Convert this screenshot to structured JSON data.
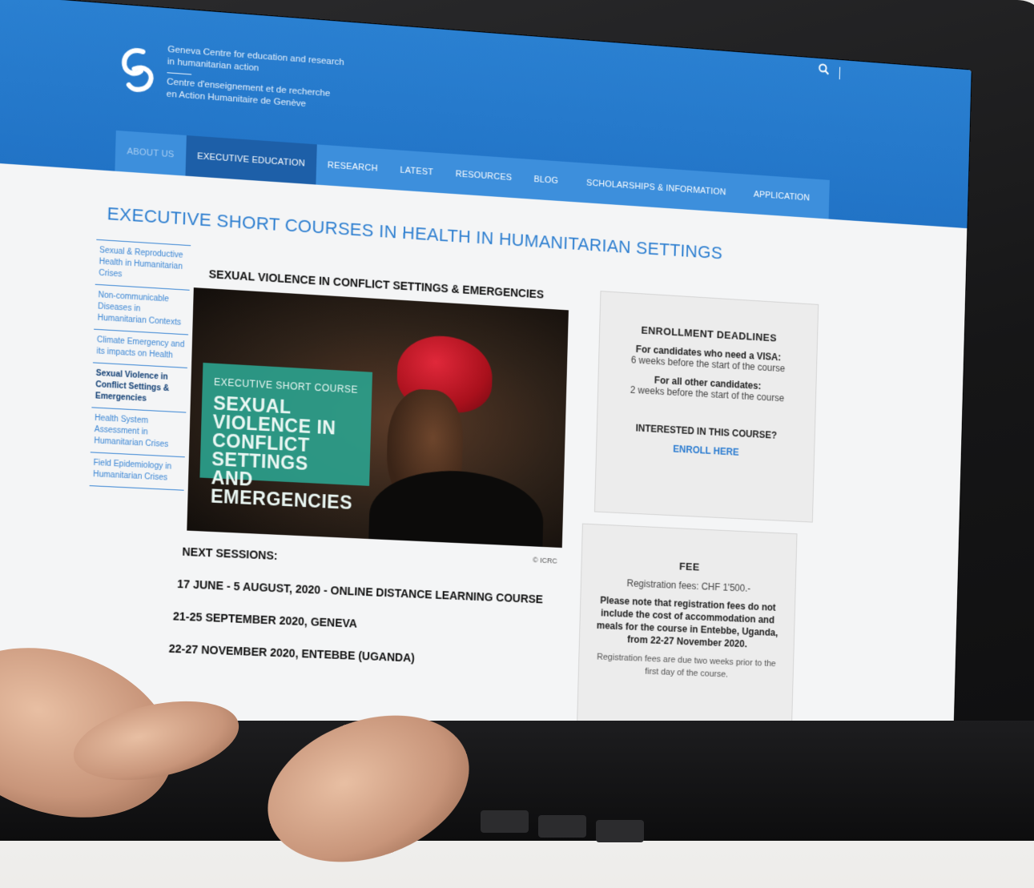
{
  "header": {
    "org_name_en_1": "Geneva Centre for education and research",
    "org_name_en_2": "in humanitarian action",
    "org_name_fr_1": "Centre d'enseignement et de recherche",
    "org_name_fr_2": "en Action Humanitaire de Genève",
    "search_icon": "search-icon"
  },
  "nav": {
    "items": [
      {
        "label": "ABOUT US"
      },
      {
        "label": "EXECUTIVE EDUCATION"
      },
      {
        "label": "RESEARCH"
      },
      {
        "label": "LATEST"
      },
      {
        "label": "RESOURCES"
      },
      {
        "label": "BLOG"
      },
      {
        "label": "SCHOLARSHIPS & INFORMATION"
      },
      {
        "label": "APPLICATION"
      }
    ]
  },
  "page": {
    "title": "EXECUTIVE SHORT COURSES IN HEALTH IN HUMANITARIAN SETTINGS",
    "course_heading": "SEXUAL VIOLENCE IN CONFLICT SETTINGS & EMERGENCIES"
  },
  "sidebar": {
    "items": [
      {
        "label": "Sexual & Reproductive Health in Humanitarian Crises"
      },
      {
        "label": "Non-communicable Diseases in Humanitarian Contexts"
      },
      {
        "label": "Climate Emergency and its impacts on Health"
      },
      {
        "label": "Sexual Violence in Conflict Settings & Emergencies"
      },
      {
        "label": "Health System Assessment in Humanitarian Crises"
      },
      {
        "label": "Field Epidemiology in Humanitarian Crises"
      }
    ]
  },
  "hero": {
    "kicker": "EXECUTIVE SHORT COURSE",
    "line1": "SEXUAL VIOLENCE IN",
    "line2": "CONFLICT SETTINGS",
    "line3": "AND EMERGENCIES",
    "credit": "© ICRC"
  },
  "sessions": {
    "label": "NEXT SESSIONS:",
    "items": [
      "17 JUNE - 5 AUGUST, 2020 - ONLINE DISTANCE LEARNING COURSE",
      "21-25 SEPTEMBER 2020, GENEVA",
      "22-27 NOVEMBER 2020, ENTEBBE (UGANDA)"
    ]
  },
  "deadlines": {
    "title": "ENROLLMENT DEADLINES",
    "visa_label": "For candidates who need a VISA:",
    "visa_value": "6 weeks before the start of the course",
    "other_label": "For all other candidates:",
    "other_value": "2 weeks before the start of the course",
    "interested": "INTERESTED IN THIS COURSE?",
    "enroll": "ENROLL HERE"
  },
  "fee": {
    "title": "FEE",
    "registration": "Registration fees: CHF 1'500.-",
    "note": "Please note that registration fees do not include the cost of accommodation and meals for the course in Entebbe, Uganda, from 22-27 November 2020.",
    "due": "Registration fees are due two weeks prior to the first day of the course."
  },
  "colors": {
    "brand_blue": "#2a80d1",
    "nav_active": "#1d5fa8",
    "hero_panel": "#2b9f8c"
  }
}
